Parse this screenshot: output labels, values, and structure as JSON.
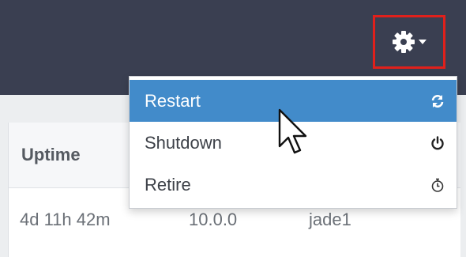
{
  "header": {
    "settings_icon": "gear-icon",
    "accent_color": "#e0201b"
  },
  "table": {
    "columns": [
      "Uptime"
    ],
    "row": {
      "uptime": "4d 11h 42m",
      "version": "10.0.0",
      "host": "jade1"
    }
  },
  "menu": {
    "items": [
      {
        "label": "Restart",
        "icon": "refresh-icon",
        "active": true
      },
      {
        "label": "Shutdown",
        "icon": "power-icon",
        "active": false
      },
      {
        "label": "Retire",
        "icon": "stopwatch-icon",
        "active": false
      }
    ],
    "highlight_color": "#428bca"
  }
}
